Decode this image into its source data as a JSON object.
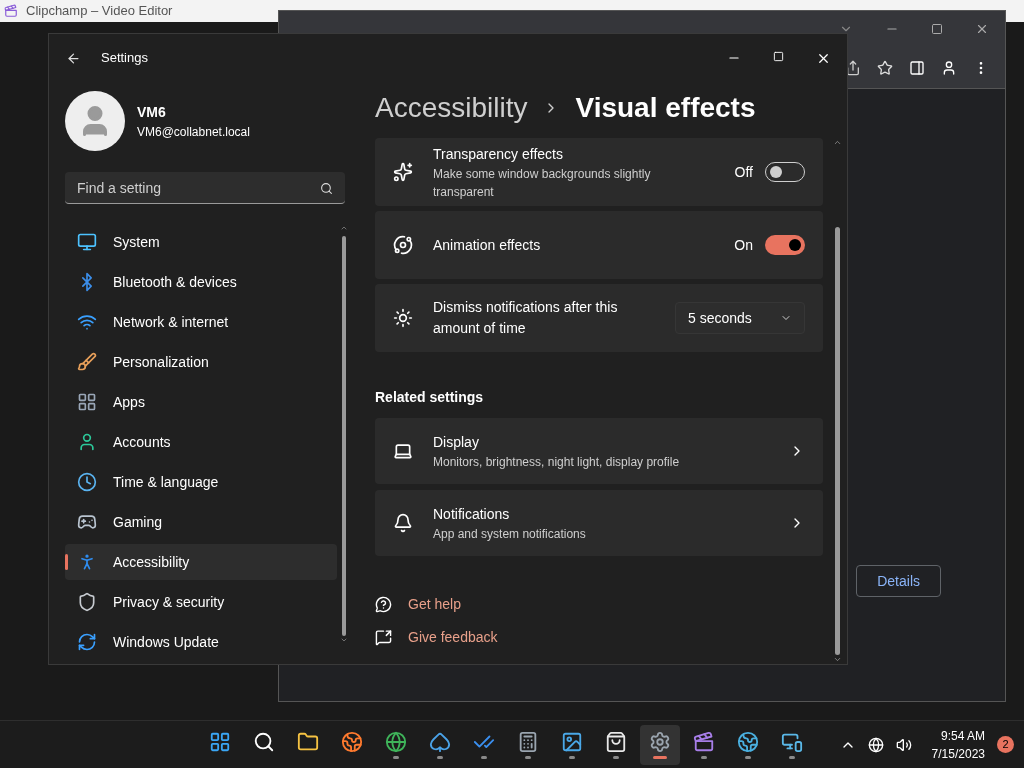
{
  "background_window": {
    "title": "Clipchamp – Video Editor"
  },
  "browser_window": {
    "button": "Details"
  },
  "settings": {
    "title": "Settings",
    "user": {
      "name": "VM6",
      "email": "VM6@collabnet.local"
    },
    "search": {
      "placeholder": "Find a setting"
    },
    "nav": [
      {
        "kind": "system",
        "label": "System",
        "selected": false
      },
      {
        "kind": "bluetooth",
        "label": "Bluetooth & devices",
        "selected": false
      },
      {
        "kind": "network",
        "label": "Network & internet",
        "selected": false
      },
      {
        "kind": "personalization",
        "label": "Personalization",
        "selected": false
      },
      {
        "kind": "apps",
        "label": "Apps",
        "selected": false
      },
      {
        "kind": "accounts",
        "label": "Accounts",
        "selected": false
      },
      {
        "kind": "time",
        "label": "Time & language",
        "selected": false
      },
      {
        "kind": "gaming",
        "label": "Gaming",
        "selected": false
      },
      {
        "kind": "accessibility",
        "label": "Accessibility",
        "selected": true
      },
      {
        "kind": "privacy",
        "label": "Privacy & security",
        "selected": false
      },
      {
        "kind": "update",
        "label": "Windows Update",
        "selected": false
      }
    ],
    "breadcrumb": {
      "parent": "Accessibility",
      "current": "Visual effects"
    },
    "options": [
      {
        "kind": "toggle",
        "title": "Transparency effects",
        "description": "Make some window backgrounds slightly transparent",
        "state_label": "Off",
        "on": false
      },
      {
        "kind": "toggle",
        "title": "Animation effects",
        "state_label": "On",
        "on": true
      },
      {
        "kind": "dropdown",
        "title": "Dismiss notifications after this amount of time",
        "value": "5 seconds"
      }
    ],
    "related_heading": "Related settings",
    "related": [
      {
        "title": "Display",
        "description": "Monitors, brightness, night light, display profile"
      },
      {
        "title": "Notifications",
        "description": "App and system notifications"
      }
    ],
    "links": [
      {
        "label": "Get help"
      },
      {
        "label": "Give feedback"
      }
    ]
  },
  "taskbar": {
    "apps": [
      {
        "kind": "start",
        "running": false,
        "selected": false
      },
      {
        "kind": "search",
        "running": false,
        "selected": false
      },
      {
        "kind": "explorer",
        "running": false,
        "selected": false
      },
      {
        "kind": "firefox",
        "running": false,
        "selected": false
      },
      {
        "kind": "chrome",
        "running": true,
        "selected": false
      },
      {
        "kind": "cards",
        "running": true,
        "selected": false
      },
      {
        "kind": "todo",
        "running": true,
        "selected": false
      },
      {
        "kind": "calculator",
        "running": true,
        "selected": false
      },
      {
        "kind": "photos",
        "running": true,
        "selected": false
      },
      {
        "kind": "store",
        "running": true,
        "selected": false
      },
      {
        "kind": "settings",
        "running": true,
        "selected": true
      },
      {
        "kind": "clipchamp",
        "running": true,
        "selected": false
      },
      {
        "kind": "network-tool",
        "running": true,
        "selected": false
      },
      {
        "kind": "remote-desktop",
        "running": true,
        "selected": false
      }
    ],
    "time": "9:54 AM",
    "date": "7/15/2023",
    "notification_count": "2"
  }
}
